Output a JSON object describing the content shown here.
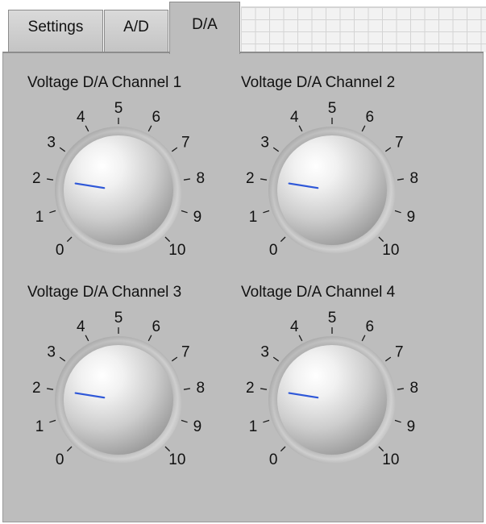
{
  "tabs": [
    {
      "label": "Settings",
      "active": false
    },
    {
      "label": "A/D",
      "active": false
    },
    {
      "label": "D/A",
      "active": true
    }
  ],
  "knobs": [
    {
      "title": "Voltage D/A Channel 1",
      "value": 2.0
    },
    {
      "title": "Voltage D/A Channel 2",
      "value": 2.0
    },
    {
      "title": "Voltage D/A Channel 3",
      "value": 2.0
    },
    {
      "title": "Voltage D/A Channel 4",
      "value": 2.0
    }
  ],
  "scale": {
    "min": 0,
    "max": 10,
    "labels": [
      "0",
      "1",
      "2",
      "3",
      "4",
      "5",
      "6",
      "7",
      "8",
      "9",
      "10"
    ]
  },
  "colors": {
    "panel": "#bdbdbd",
    "needle": "#2f58d8"
  }
}
